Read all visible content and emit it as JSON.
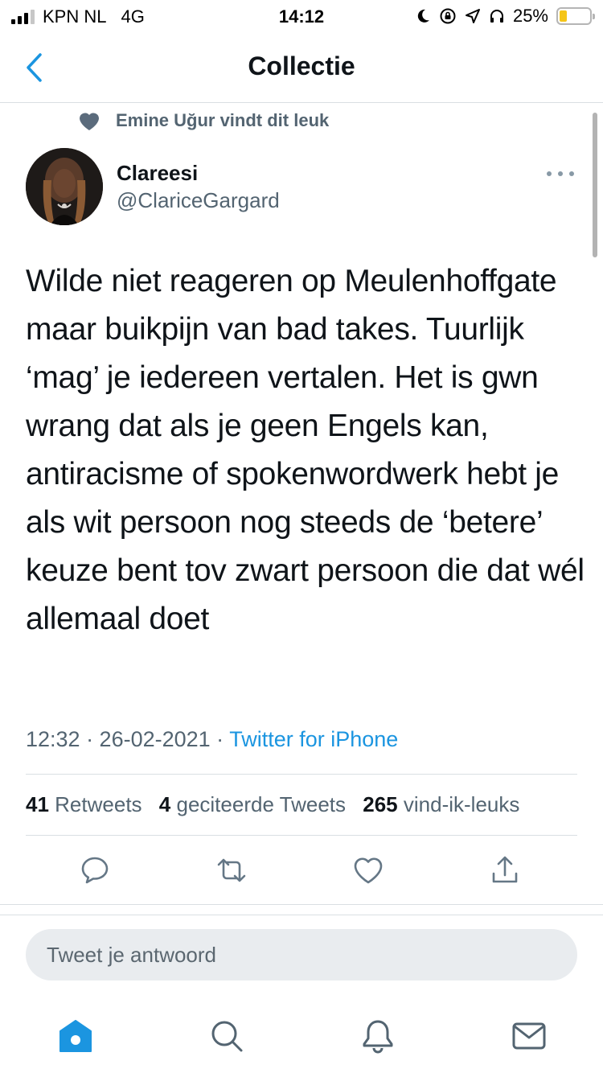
{
  "status_bar": {
    "carrier": "KPN NL",
    "network": "4G",
    "time": "14:12",
    "battery_percent": "25%",
    "battery_level": 0.25
  },
  "header": {
    "title": "Collectie",
    "back_icon": "chevron-left-icon"
  },
  "tweet": {
    "social_context": "Emine Uğur vindt dit leuk",
    "author_name": "Clareesi",
    "author_handle": "@ClariceGargard",
    "text": "Wilde niet reageren op Meulenhoffgate maar buikpijn van bad takes. Tuurlijk ‘mag’ je iedereen vertalen. Het is gwn wrang dat als je geen Engels kan, antiracisme of spokenwordwerk hebt je als wit persoon nog steeds de ‘betere’ keuze bent tov zwart persoon die dat wél allemaal doet",
    "timestamp": "12:32 · 26-02-2021 · ",
    "source": "Twitter for iPhone",
    "stats": {
      "retweets_count": "41",
      "retweets_label": "Retweets",
      "quotes_count": "4",
      "quotes_label": "geciteerde Tweets",
      "likes_count": "265",
      "likes_label": "vind-ik-leuks"
    }
  },
  "reply": {
    "placeholder": "Tweet je antwoord"
  },
  "colors": {
    "accent": "#1b95e0",
    "text_primary": "#0f1419",
    "text_secondary": "#536471",
    "divider": "#dadfe3",
    "reply_bg": "#e9ecef"
  },
  "tab_bar": {
    "items": [
      "home-icon",
      "search-icon",
      "notifications-icon",
      "messages-icon"
    ],
    "active": "home-icon"
  }
}
